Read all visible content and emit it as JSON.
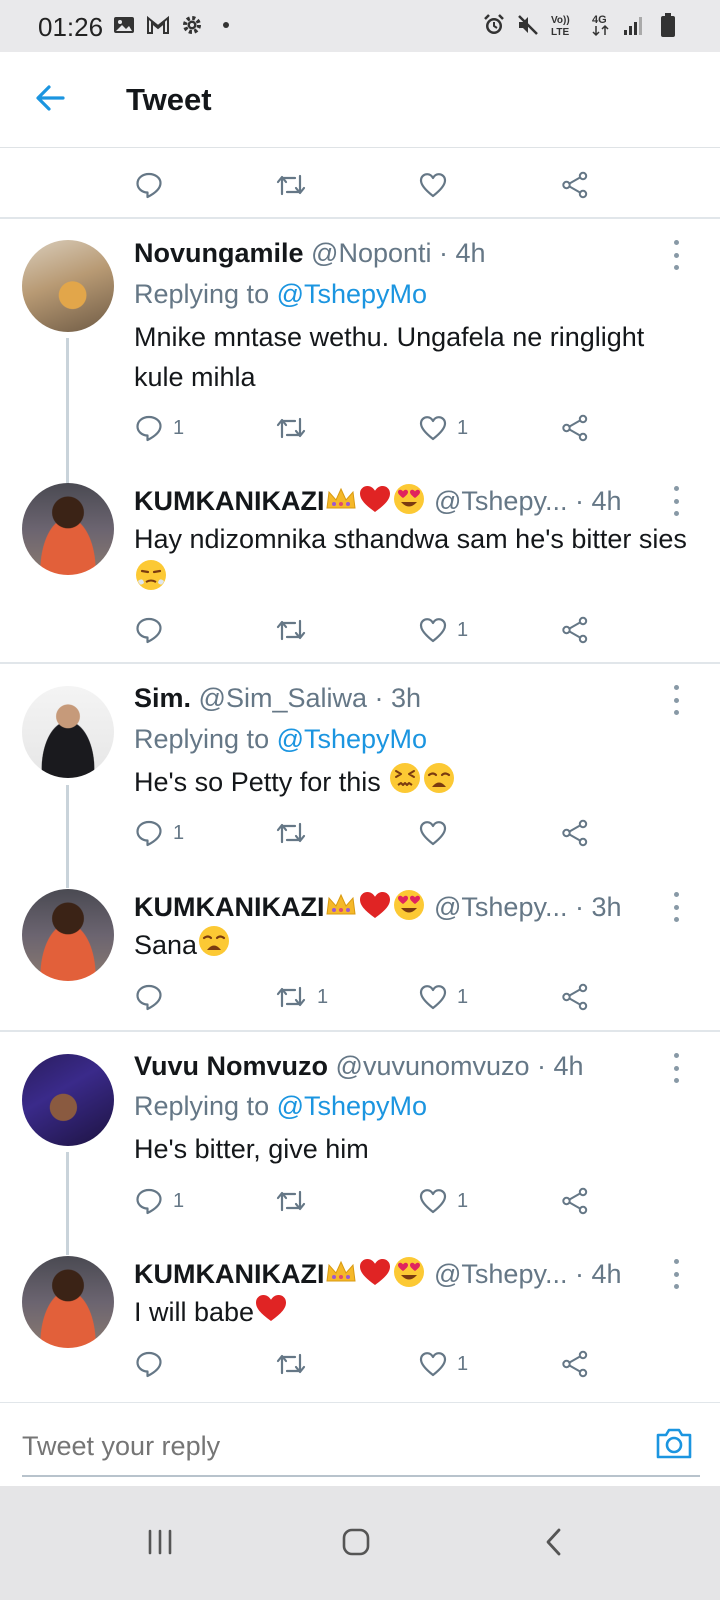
{
  "status_bar": {
    "time": "01:26",
    "left_icons": [
      "gallery-icon",
      "gmail-icon",
      "settings-icon",
      "dot-icon"
    ],
    "right_icons": [
      "alarm-icon",
      "mute-icon",
      "volte-icon",
      "4g-icon",
      "signal-icon",
      "battery-icon"
    ],
    "volte_text": "Vo)) LTE",
    "network_text": "4G"
  },
  "header": {
    "title": "Tweet"
  },
  "reply_prefix": "Replying to ",
  "tweets": [
    {
      "name": "Novungamile",
      "handle": "@Noponti",
      "time": "· 4h",
      "replying_to": "@TshepyMo",
      "text": "Mnike mntase wethu. Ungafela ne ringlight kule mihla",
      "reply_count": "1",
      "retweet_count": "",
      "like_count": "1"
    },
    {
      "name": "KUMKANIKAZI",
      "handle": "@Tshepy...",
      "time": "· 4h",
      "text": "Hay ndizomnika sthandwa sam he's bitter sies",
      "reply_count": "",
      "retweet_count": "",
      "like_count": "1"
    },
    {
      "name": "Sim.",
      "handle": "@Sim_Saliwa",
      "time": "· 3h",
      "replying_to": "@TshepyMo",
      "text": "He's so Petty for this",
      "reply_count": "1",
      "retweet_count": "",
      "like_count": ""
    },
    {
      "name": "KUMKANIKAZI",
      "handle": "@Tshepy...",
      "time": "· 3h",
      "text": "Sana",
      "reply_count": "",
      "retweet_count": "1",
      "like_count": "1"
    },
    {
      "name": "Vuvu Nomvuzo",
      "handle": "@vuvunomvuzo",
      "time": "· 4h",
      "replying_to": "@TshepyMo",
      "text": "He's bitter, give him",
      "reply_count": "1",
      "retweet_count": "",
      "like_count": "1"
    },
    {
      "name": "KUMKANIKAZI",
      "handle": "@Tshepy...",
      "time": "· 4h",
      "text": "I will babe",
      "reply_count": "",
      "retweet_count": "",
      "like_count": "1"
    }
  ],
  "reply_bar": {
    "placeholder": "Tweet your reply"
  },
  "colors": {
    "accent": "#1b95e0",
    "muted": "#657786",
    "text": "#14171a",
    "divider": "#e1e6ea"
  }
}
